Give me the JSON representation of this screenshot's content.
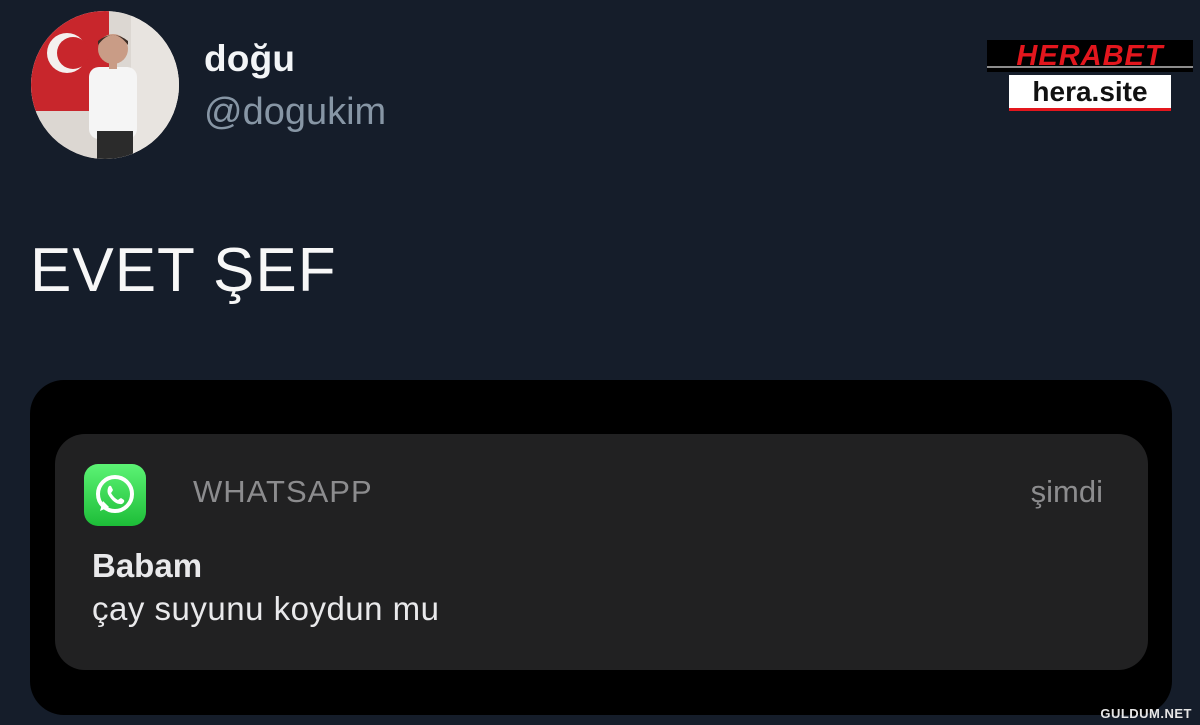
{
  "tweet": {
    "display_name": "doğu",
    "handle": "@dogukim",
    "text": "EVET ŞEF"
  },
  "brand": {
    "logo_text": "HERABET",
    "site_text": "hera.site",
    "accent_color": "#e3161d"
  },
  "notification": {
    "app_icon": "whatsapp-icon",
    "app_name": "WHATSAPP",
    "time": "şimdi",
    "sender": "Babam",
    "message": "çay suyunu koydun mu"
  },
  "watermark": "GULDUM.NET",
  "colors": {
    "background": "#151d2a",
    "handle": "#8796a5",
    "notification_bg": "#212122",
    "whatsapp_green": "#25d366"
  }
}
